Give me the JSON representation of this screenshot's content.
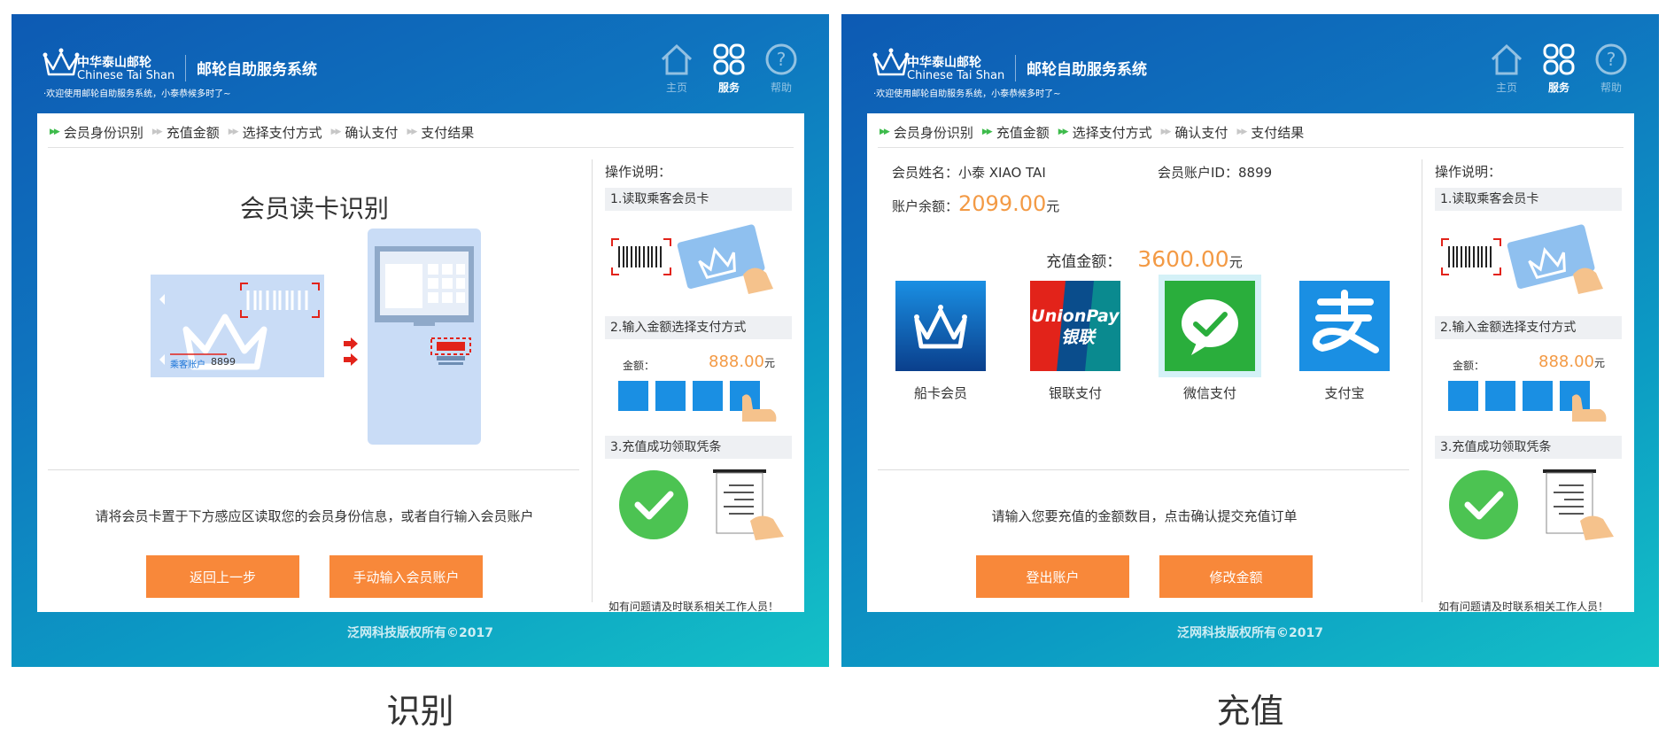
{
  "common": {
    "brand_cn": "中华泰山邮轮",
    "brand_en": "Chinese Tai Shan",
    "app_title": "邮轮自助服务系统",
    "welcome": "·欢迎使用邮轮自助服务系统，小泰恭候多时了~",
    "nav": {
      "home": "主页",
      "service": "服务",
      "help": "帮助"
    },
    "steps": [
      "会员身份识别",
      "充值金额",
      "选择支付方式",
      "确认支付",
      "支付结果"
    ],
    "copyright": "泛网科技版权所有©2017",
    "help": {
      "title": "操作说明：",
      "step1": "1.读取乘客会员卡",
      "step2": "2.输入金额选择支付方式",
      "step3": "3.充值成功领取凭条",
      "amount_label": "金额：",
      "amount_value": "888.00",
      "amount_unit": "元",
      "footer": "如有问题请及时联系相关工作人员！"
    }
  },
  "left_screen": {
    "caption": "识别",
    "title": "会员读卡识别",
    "card_account_label": "乘客账户",
    "card_account_number": "8899",
    "hint": "请将会员卡置于下方感应区读取您的会员身份信息，或者自行输入会员账户",
    "buttons": {
      "back": "返回上一步",
      "manual": "手动输入会员账户"
    },
    "steps_done": 1
  },
  "right_screen": {
    "caption": "充值",
    "member_name_label": "会员姓名：",
    "member_name": "小泰  XIAO TAI",
    "member_id_label": "会员账户ID：",
    "member_id": "8899",
    "balance_label": "账户余额：",
    "balance": "2099.00",
    "balance_unit": "元",
    "recharge_label": "充值金额：",
    "recharge_amount": "3600.00",
    "recharge_unit": "元",
    "payments": [
      {
        "label": "船卡会员"
      },
      {
        "label": "银联支付"
      },
      {
        "label": "微信支付"
      },
      {
        "label": "支付宝"
      }
    ],
    "hint": "请输入您要充值的金额数目，点击确认提交充值订单",
    "buttons": {
      "logout": "登出账户",
      "modify": "修改金额"
    },
    "steps_done": 3,
    "colors": {
      "unionpay_red": "#e2231a",
      "unionpay_blue": "#0a4d8c",
      "unionpay_teal": "#0a8a8f",
      "wechat": "#2aae3c",
      "alipay": "#1a8fe3"
    }
  },
  "colors": {
    "accent_orange": "#f8883a",
    "amount_orange": "#f39a45",
    "step_green": "#3dbb4b"
  }
}
